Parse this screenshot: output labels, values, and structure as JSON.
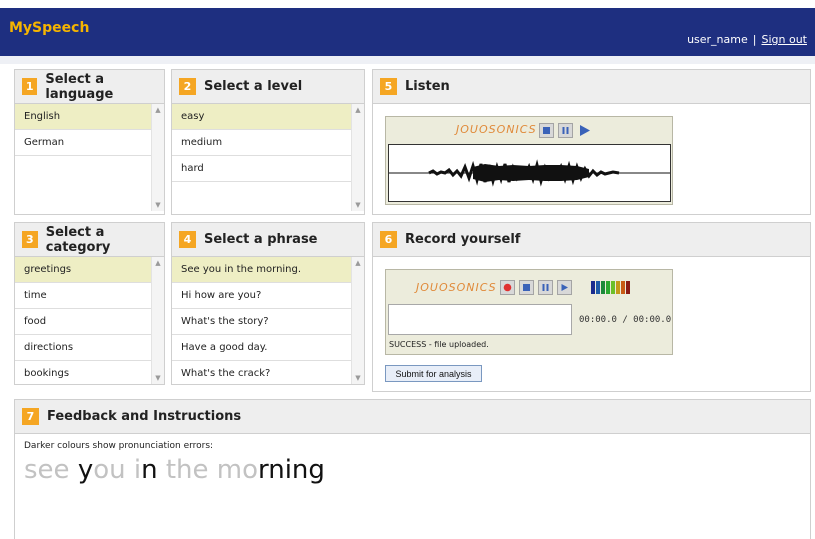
{
  "app": {
    "title": "MySpeech"
  },
  "user": {
    "name": "user_name",
    "separator": "|",
    "sign_out": "Sign out"
  },
  "panels": {
    "language": {
      "number": "1",
      "title": "Select a language",
      "items": [
        "English",
        "German"
      ],
      "selected": "English"
    },
    "level": {
      "number": "2",
      "title": "Select a level",
      "items": [
        "easy",
        "medium",
        "hard"
      ],
      "selected": "easy"
    },
    "listen": {
      "number": "5",
      "title": "Listen"
    },
    "category": {
      "number": "3",
      "title": "Select a category",
      "items": [
        "greetings",
        "time",
        "food",
        "directions",
        "bookings"
      ],
      "selected": "greetings"
    },
    "phrase": {
      "number": "4",
      "title": "Select a phrase",
      "items": [
        "See you in the morning.",
        "Hi how are you?",
        "What's the story?",
        "Have a good day.",
        "What's the crack?"
      ],
      "selected": "See you in the morning."
    },
    "record": {
      "number": "6",
      "title": "Record yourself"
    },
    "feedback": {
      "number": "7",
      "title": "Feedback and Instructions"
    }
  },
  "listen_player": {
    "brand": "JOUOSONICS"
  },
  "record_player": {
    "brand": "JOUOSONICS",
    "timer": "00:00.0 / 00:00.0",
    "status": "SUCCESS - file uploaded.",
    "meter_colors": [
      "#1a2c8e",
      "#1d5aa8",
      "#1c8a3a",
      "#2aa830",
      "#6cbf2a",
      "#c49a1a",
      "#c85a14",
      "#8a1a14"
    ]
  },
  "submit_label": "Submit for analysis",
  "feedback": {
    "note": "Darker colours show pronunciation errors:",
    "words": [
      {
        "text": "see ",
        "color": "#c2c2c2"
      },
      {
        "text": "y",
        "color": "#111111"
      },
      {
        "text": "ou i",
        "color": "#c2c2c2"
      },
      {
        "text": "n",
        "color": "#111111"
      },
      {
        "text": " the mo",
        "color": "#c2c2c2"
      },
      {
        "text": "rning",
        "color": "#111111"
      }
    ]
  },
  "colors": {
    "header_bg": "#1e2f80",
    "logo": "#f5b400",
    "step_badge": "#f5a623",
    "selected_row": "#eeeec4"
  },
  "icons": {
    "stop": "stop-icon",
    "pause": "pause-icon",
    "play": "play-icon",
    "record": "record-icon",
    "scroll_up": "scroll-up-icon",
    "scroll_down": "scroll-down-icon"
  }
}
